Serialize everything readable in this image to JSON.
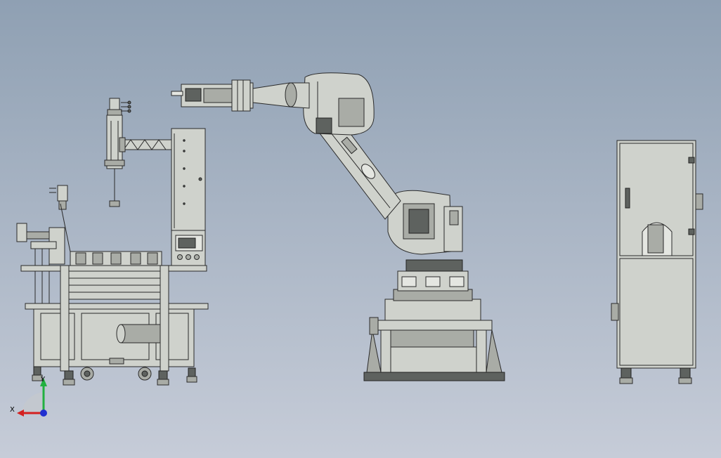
{
  "viewport": {
    "background_top": "#8fa0b3",
    "background_bottom": "#c6ccd8"
  },
  "triad": {
    "x_label": "X",
    "y_label": "Y",
    "x_color": "#d42020",
    "y_color": "#22b040",
    "z_color": "#2030d0"
  },
  "colors": {
    "machine_body": "#cfd2cc",
    "machine_dark": "#a9aca6",
    "outline": "#2a2a2a"
  }
}
